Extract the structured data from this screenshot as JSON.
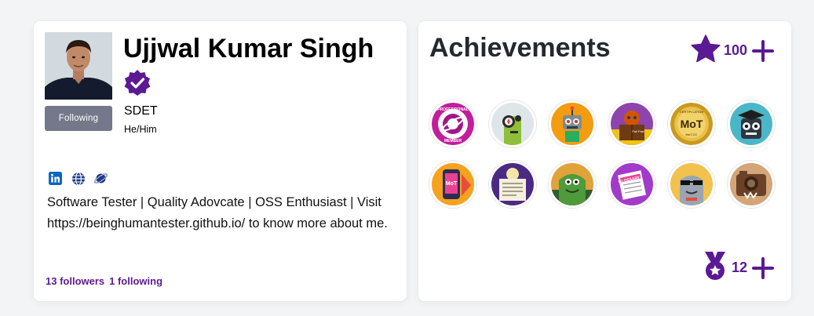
{
  "profile": {
    "name": "Ujjwal Kumar Singh",
    "follow_button": "Following",
    "role": "SDET",
    "pronouns": "He/Him",
    "social_links": [
      "linkedin-icon",
      "globe-icon",
      "planet-icon"
    ],
    "bio": "Software Tester | Quality Adovcate | OSS Enthusiast | Visit https://beinghumantester.github.io/ to know more about me.",
    "followers": "13 followers",
    "following": "1 following"
  },
  "achievements": {
    "title": "Achievements",
    "points": "100",
    "medals": "12",
    "badges": [
      {
        "icon": "professional-member-badge",
        "text_top": "PROFESSIONAL",
        "text_bottom": "MEMBER"
      },
      {
        "icon": "compass-bot-badge"
      },
      {
        "icon": "robot-badge"
      },
      {
        "icon": "reader-bot-badge",
        "text": "Fail Fast"
      },
      {
        "icon": "mot-certified-badge",
        "text_top": "CERTIFICATION",
        "text": "MoT",
        "text_bottom": "MoT-CC"
      },
      {
        "icon": "graduate-bot-badge"
      },
      {
        "icon": "phone-mot-badge",
        "text": "MoT"
      },
      {
        "icon": "newspaper-reader-badge"
      },
      {
        "icon": "green-monster-badge"
      },
      {
        "icon": "glossary-badge",
        "text": "GLOSSARY"
      },
      {
        "icon": "cool-sunglasses-badge"
      },
      {
        "icon": "camera-bot-badge"
      }
    ]
  },
  "colors": {
    "accent": "#5b1a93",
    "follow_button": "#74788a",
    "linkedin": "#0a66c2"
  }
}
